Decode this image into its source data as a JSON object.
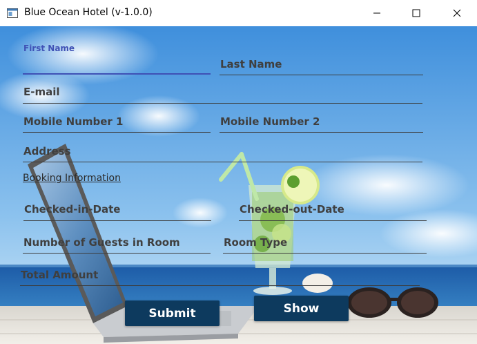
{
  "window": {
    "title": "Blue Ocean Hotel (v-1.0.0)"
  },
  "form": {
    "first_name_label": "First Name",
    "last_name_label": "Last Name",
    "email_label": "E-mail",
    "mobile1_label": "Mobile Number 1",
    "mobile2_label": "Mobile Number 2",
    "address_label": "Address",
    "booking_link": "Booking Information",
    "checkin_label": "Checked-in-Date",
    "checkout_label": "Checked-out-Date",
    "guests_label": "Number of Guests in Room",
    "room_type_label": "Room Type",
    "total_label": "Total Amount"
  },
  "buttons": {
    "submit": "Submit",
    "show": "Show"
  },
  "colors": {
    "accent": "#3f51b5",
    "button": "#0d3a5e",
    "sky": "#2f7fd0",
    "sea": "#1f5fa8"
  }
}
